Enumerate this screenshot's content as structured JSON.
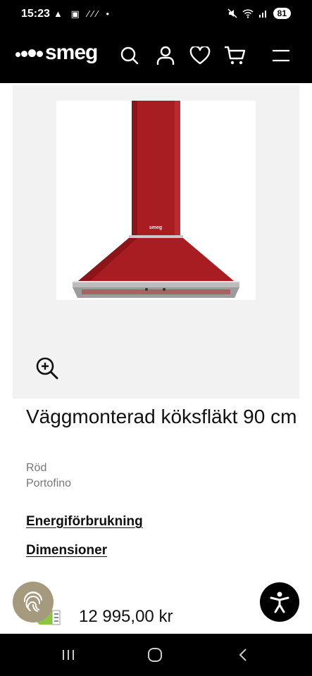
{
  "status_bar": {
    "time": "15:23",
    "left_icons": "▲ ▣ ⁄⁄⁄ •",
    "battery": "81"
  },
  "header": {
    "logo_text": "smeg",
    "icons": [
      "search-icon",
      "account-icon",
      "heart-icon",
      "cart-icon",
      "menu-icon"
    ]
  },
  "product": {
    "title": "Väggmonterad köksfläkt 90 cm",
    "color": "Röd",
    "line": "Portofino",
    "image_brand": "smeg",
    "hood_color": "#a81d22"
  },
  "links": {
    "energy": "Energiförbrukning",
    "dimensions": "Dimensioner"
  },
  "price": "12 995,00 kr",
  "colors": {
    "header_bg": "#000000",
    "panel_bg": "#f2f2f2",
    "fingerprint_bg": "#a59a7e"
  }
}
